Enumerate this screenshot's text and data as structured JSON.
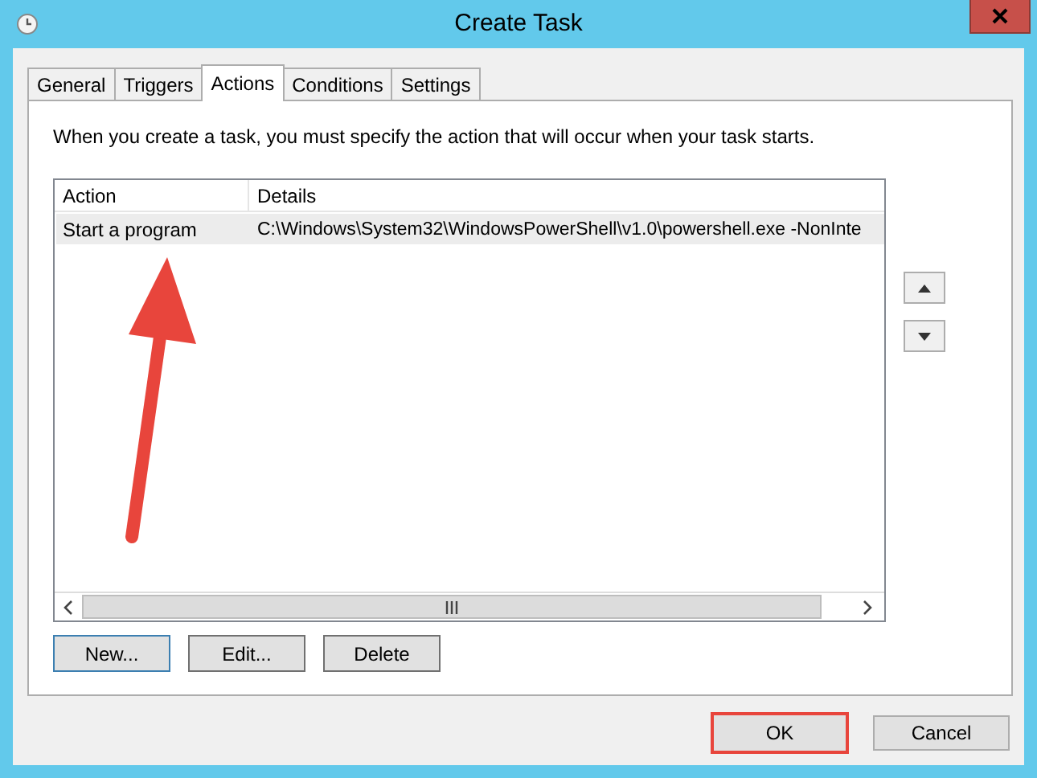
{
  "window": {
    "title": "Create Task"
  },
  "tabs": [
    {
      "label": "General",
      "selected": false
    },
    {
      "label": "Triggers",
      "selected": false
    },
    {
      "label": "Actions",
      "selected": true
    },
    {
      "label": "Conditions",
      "selected": false
    },
    {
      "label": "Settings",
      "selected": false
    }
  ],
  "description": "When you create a task, you must specify the action that will occur when your task starts.",
  "table": {
    "columns": [
      "Action",
      "Details"
    ],
    "rows": [
      {
        "cells": [
          "Start a program",
          "C:\\Windows\\System32\\WindowsPowerShell\\v1.0\\powershell.exe -NonInte"
        ],
        "selected": true
      }
    ]
  },
  "action_buttons": [
    {
      "label": "New...",
      "focused": true
    },
    {
      "label": "Edit...",
      "focused": false
    },
    {
      "label": "Delete",
      "focused": false
    }
  ],
  "footer_buttons": [
    {
      "label": "OK",
      "highlighted": true
    },
    {
      "label": "Cancel",
      "highlighted": false
    }
  ]
}
